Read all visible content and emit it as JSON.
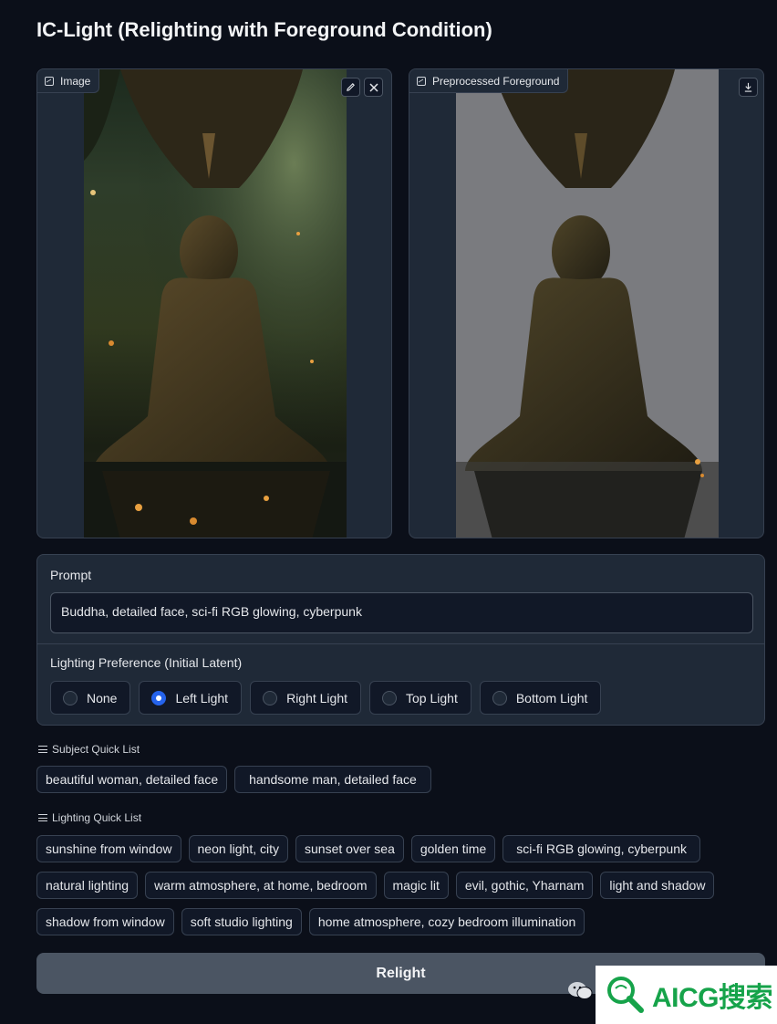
{
  "app": {
    "title": "IC-Light (Relighting with Foreground Condition)"
  },
  "image_panel": {
    "label": "Image",
    "edit_icon": "pencil-icon",
    "clear_icon": "close-icon"
  },
  "foreground_panel": {
    "label": "Preprocessed Foreground",
    "download_icon": "download-icon"
  },
  "prompt": {
    "label": "Prompt",
    "value": "Buddha, detailed face, sci-fi RGB glowing, cyberpunk"
  },
  "lighting_preference": {
    "label": "Lighting Preference (Initial Latent)",
    "options": [
      "None",
      "Left Light",
      "Right Light",
      "Top Light",
      "Bottom Light"
    ],
    "selected": "Left Light"
  },
  "subject_quick_list": {
    "label": "Subject Quick List",
    "items": [
      "beautiful woman, detailed face",
      "handsome man, detailed face"
    ]
  },
  "lighting_quick_list": {
    "label": "Lighting Quick List",
    "items": [
      "sunshine from window",
      "neon light, city",
      "sunset over sea",
      "golden time",
      "sci-fi RGB glowing, cyberpunk",
      "natural lighting",
      "warm atmosphere, at home, bedroom",
      "magic lit",
      "evil, gothic, Yharnam",
      "light and shadow",
      "shadow from window",
      "soft studio lighting",
      "home atmosphere, cozy bedroom illumination"
    ]
  },
  "relight_button": {
    "label": "Relight"
  },
  "watermark": {
    "text": "AICG搜索"
  },
  "colors": {
    "accent": "#2563eb",
    "background": "#0b0f19",
    "panel": "#1f2937"
  }
}
